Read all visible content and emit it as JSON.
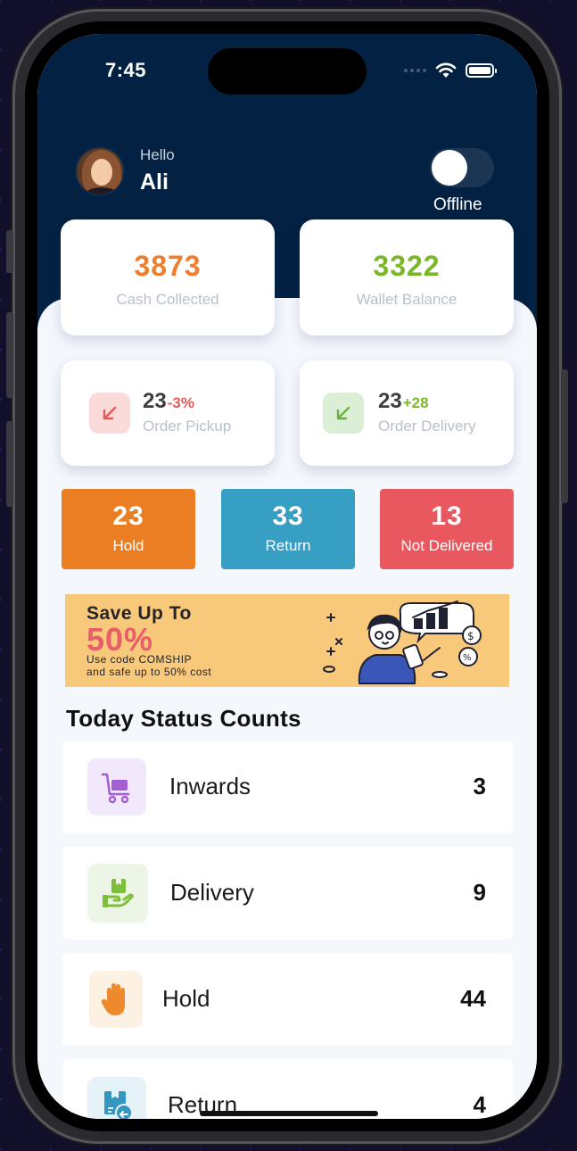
{
  "status_bar": {
    "time": "7:45"
  },
  "header": {
    "greeting": "Hello",
    "user_name": "Ali",
    "availability_label": "Offline",
    "availability_on": false
  },
  "summary_cards": [
    {
      "value": "3873",
      "label": "Cash Collected",
      "color": "#ee7e2e"
    },
    {
      "value": "3322",
      "label": "Wallet Balance",
      "color": "#7ab82a"
    }
  ],
  "order_cards": [
    {
      "value": "23",
      "change": "-3%",
      "label": "Order Pickup",
      "change_color": "#e35a5a",
      "icon": "arrow-down-left-icon",
      "icon_bg": "#fbdada",
      "icon_color": "#e35a5a"
    },
    {
      "value": "23",
      "change": "+28",
      "label": "Order Delivery",
      "change_color": "#7ab82a",
      "icon": "arrow-down-left-icon",
      "icon_bg": "#dcefd6",
      "icon_color": "#6bb045"
    }
  ],
  "status_tiles": [
    {
      "value": "23",
      "label": "Hold",
      "color": "#eb7d22"
    },
    {
      "value": "33",
      "label": "Return",
      "color": "#379ec4"
    },
    {
      "value": "13",
      "label": "Not Delivered",
      "color": "#e9585e"
    }
  ],
  "promo_banner": {
    "title": "Save Up To",
    "percent": "50%",
    "line1": "Use code COMSHIP",
    "line2": "and safe up to 50% cost"
  },
  "today_status": {
    "title": "Today Status Counts",
    "items": [
      {
        "label": "Inwards",
        "count": "3",
        "icon": "cart-icon",
        "icon_bg": "#f2e8fb",
        "icon_color": "#a55fd4"
      },
      {
        "label": "Delivery",
        "count": "9",
        "icon": "package-hand-icon",
        "icon_bg": "#edf6e6",
        "icon_color": "#7bbf3a"
      },
      {
        "label": "Hold",
        "count": "44",
        "icon": "hand-icon",
        "icon_bg": "#fdf1e3",
        "icon_color": "#ee8a2e"
      },
      {
        "label": "Return",
        "count": "4",
        "icon": "return-box-icon",
        "icon_bg": "#e5f2f8",
        "icon_color": "#3596c0"
      }
    ]
  }
}
